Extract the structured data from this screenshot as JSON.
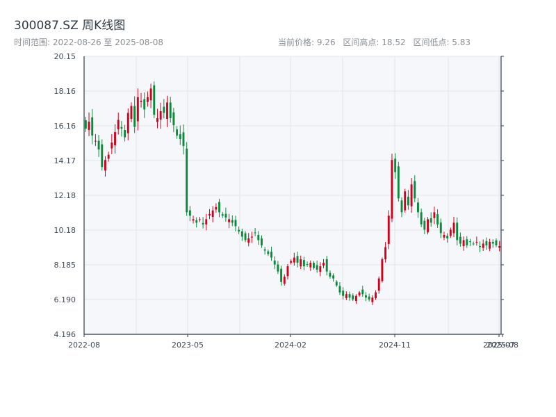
{
  "header": {
    "title": "300087.SZ 周K线图",
    "range_label": "时间范围: 2022-08-26 至 2025-08-08",
    "current_price": "当前价格: 9.26",
    "period_high": "区间高点: 18.52",
    "period_low": "区间低点: 5.83"
  },
  "colors": {
    "up": "#d0021b",
    "down": "#0a8a3a",
    "plot_bg": "#f5f7fa",
    "grid": "#e3e6ea",
    "axis": "#2f3a44"
  },
  "chart_data": {
    "type": "candlestick",
    "title": "300087.SZ 周K线图",
    "ylim": [
      4.196,
      20.15
    ],
    "y_ticks": [
      "20.15",
      "18.16",
      "16.16",
      "14.17",
      "12.18",
      "10.18",
      "8.185",
      "6.190",
      "4.196"
    ],
    "x_ticks": [
      "2022-08",
      "2023-05",
      "2024-02",
      "2024-11",
      "2025-07",
      "2025-08"
    ],
    "grid": true,
    "series_close": [
      16.0,
      16.4,
      15.6,
      15.3,
      14.8,
      13.8,
      14.2,
      14.5,
      15.2,
      15.8,
      16.5,
      16.0,
      15.5,
      16.9,
      17.3,
      16.1,
      17.8,
      17.6,
      17.1,
      17.8,
      18.3,
      16.8,
      16.6,
      17.0,
      16.9,
      17.5,
      16.6,
      16.2,
      15.6,
      15.4,
      15.0,
      11.2,
      11.0,
      10.8,
      10.6,
      10.8,
      10.5,
      10.8,
      11.1,
      11.3,
      11.5,
      11.2,
      11.0,
      10.9,
      10.8,
      10.6,
      10.4,
      10.1,
      9.8,
      9.6,
      9.7,
      9.8,
      10.0,
      9.6,
      9.3,
      9.0,
      8.8,
      8.6,
      8.2,
      7.8,
      7.2,
      7.5,
      8.1,
      8.4,
      8.6,
      8.3,
      8.5,
      8.1,
      8.2,
      8.3,
      8.0,
      7.9,
      8.1,
      8.3,
      7.8,
      7.5,
      7.4,
      7.0,
      6.6,
      6.4,
      6.5,
      6.3,
      6.2,
      6.4,
      6.6,
      6.5,
      6.3,
      6.2,
      6.3,
      6.6,
      7.4,
      8.5,
      9.2,
      11.0,
      14.2,
      13.5,
      12.0,
      11.2,
      12.4,
      11.6,
      12.8,
      12.0,
      11.2,
      10.5,
      10.2,
      10.8,
      10.6,
      11.2,
      10.5,
      10.0,
      9.9,
      9.7,
      10.2,
      10.6,
      9.6,
      9.4,
      9.6,
      9.3,
      9.5,
      9.4,
      9.5,
      9.2,
      9.4,
      9.3,
      9.5,
      9.4,
      9.3,
      9.26
    ],
    "period_high": 18.52,
    "period_low": 5.83
  }
}
